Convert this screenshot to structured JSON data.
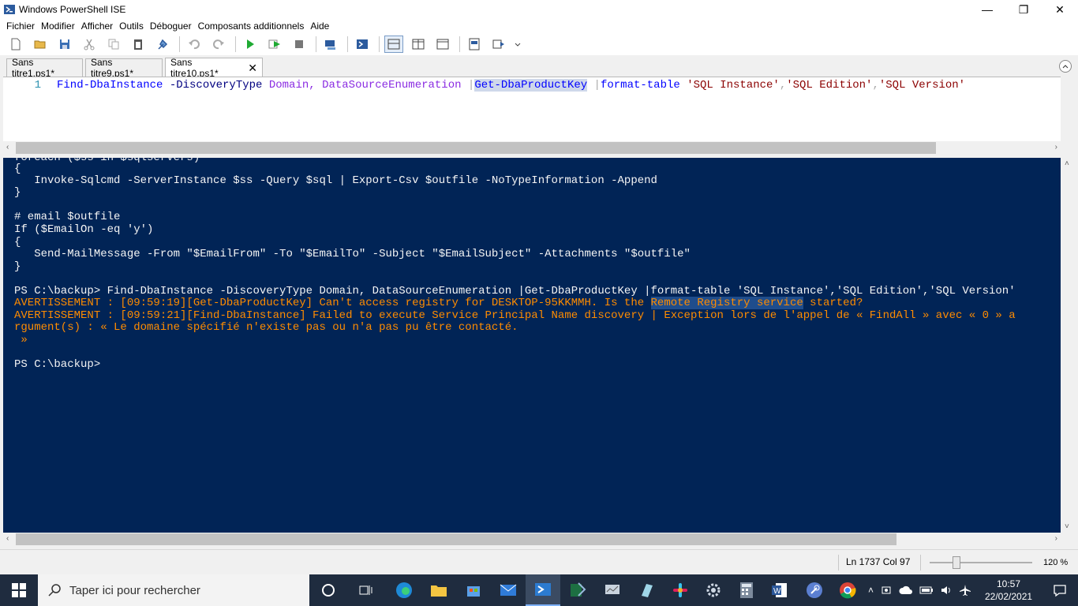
{
  "window": {
    "title": "Windows PowerShell ISE",
    "minimize": "—",
    "restore": "❐",
    "close": "✕"
  },
  "menu": [
    "Fichier",
    "Modifier",
    "Afficher",
    "Outils",
    "Déboguer",
    "Composants additionnels",
    "Aide"
  ],
  "tabs": [
    {
      "label": "Sans titre1.ps1*"
    },
    {
      "label": "Sans titre9.ps1*"
    },
    {
      "label": "Sans titre10.ps1*",
      "close": "✕"
    }
  ],
  "editor": {
    "line_number": "1",
    "tokens": {
      "cmd1": "Find-DbaInstance",
      "param1": " -DiscoveryType",
      "arg1": " Domain,",
      "arg2": " DataSourceEnumeration",
      "pipe1": " |",
      "cmd2": "Get-DbaProductKey",
      "pipe2": " |",
      "cmd3": "format-table",
      "str1": " 'SQL Instance'",
      "comma1": ",",
      "str2": "'SQL Edition'",
      "comma2": ",",
      "str3": "'SQL Version'"
    }
  },
  "console": {
    "lines": [
      "foreach ($ss in $sqlservers)",
      "{",
      "   Invoke-Sqlcmd -ServerInstance $ss -Query $sql | Export-Csv $outfile -NoTypeInformation -Append",
      "}",
      "",
      "# email $outfile",
      "If ($EmailOn -eq 'y')",
      "{",
      "   Send-MailMessage -From \"$EmailFrom\" -To \"$EmailTo\" -Subject \"$EmailSubject\" -Attachments \"$outfile\"",
      "}",
      "",
      "PS C:\\backup> Find-DbaInstance -DiscoveryType Domain, DataSourceEnumeration |Get-DbaProductKey |format-table 'SQL Instance','SQL Edition','SQL Version'"
    ],
    "warn1_pre": "AVERTISSEMENT : [09:59:19][Get-DbaProductKey] Can't access registry for DESKTOP-95KKMMH. Is the ",
    "warn1_sel": "Remote Registry service",
    "warn1_post": " started?",
    "warn2_a": "AVERTISSEMENT : [09:59:21][Find-DbaInstance] Failed to execute Service Principal Name discovery | Exception lors de l'appel de « FindAll » avec « 0 » a",
    "warn2_b": "rgument(s) : « Le domaine spécifié n'existe pas ou n'a pas pu être contacté.",
    "warn2_c": " »",
    "prompt": "PS C:\\backup>"
  },
  "status": {
    "position": "Ln 1737  Col 97",
    "zoom": "120 %"
  },
  "taskbar": {
    "search_placeholder": "Taper ici pour rechercher",
    "time": "10:57",
    "date": "22/02/2021"
  },
  "colors": {
    "console_bg": "#012456",
    "warning": "#ff8c00",
    "taskbar": "#1f2c3f"
  }
}
